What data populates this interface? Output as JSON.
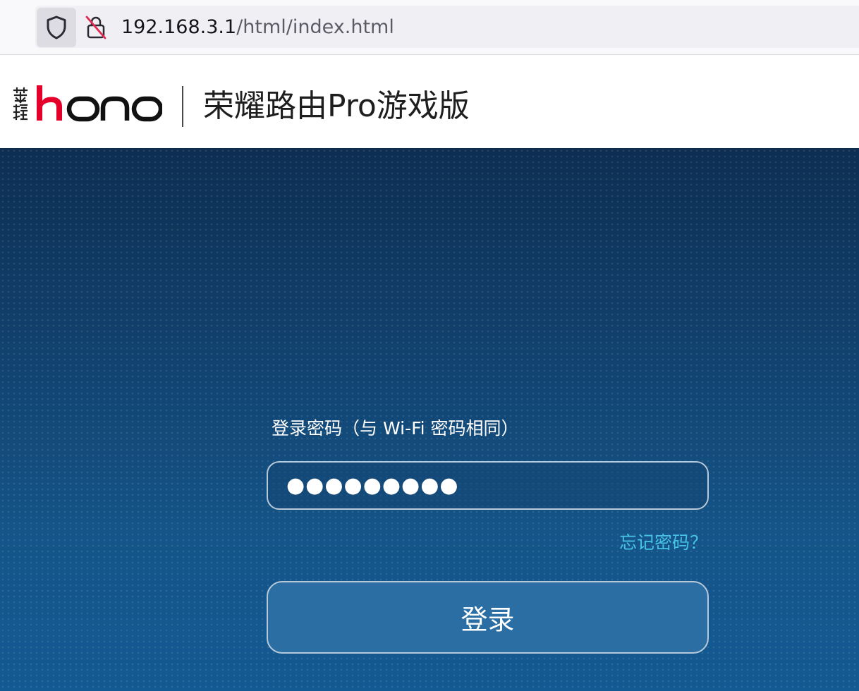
{
  "browser": {
    "url_host": "192.168.3.1",
    "url_path": "/html/index.html",
    "shield_icon": "tracking-protection-shield-icon",
    "lock_icon": "insecure-connection-lock-icon"
  },
  "header": {
    "logo_text": "honor",
    "logo_cn": "荣耀",
    "title": "荣耀路由Pro游戏版"
  },
  "login": {
    "password_label": "登录密码（与 Wi-Fi 密码相同）",
    "password_value": "●●●●●●●●●",
    "forgot_link": "忘记密码？",
    "login_button": "登录"
  },
  "colors": {
    "accent_link": "#46c3e6",
    "logo_red": "#e4002b",
    "background_blue": "#134a7a"
  }
}
